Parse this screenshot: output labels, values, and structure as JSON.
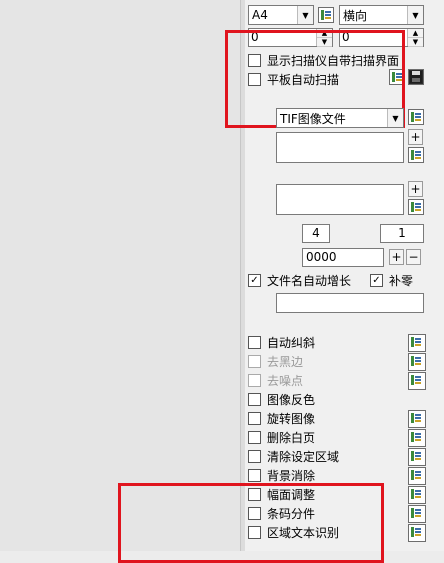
{
  "page_size": {
    "value": "A4"
  },
  "orientation": {
    "value": "横向"
  },
  "margin_left": {
    "value": "0"
  },
  "margin_right": {
    "value": "0"
  },
  "checkbox_show_scanner_ui": {
    "label": "显示扫描仪自带扫描界面",
    "checked": false
  },
  "checkbox_flatbed_auto": {
    "label": "平板自动扫描",
    "checked": false
  },
  "file_type": {
    "value": "TIF图像文件"
  },
  "counter": {
    "start": "4",
    "step": "1"
  },
  "name_pattern": {
    "value": "0000"
  },
  "checkbox_filename_autoincrement": {
    "label": "文件名自动增长",
    "checked": true
  },
  "checkbox_zero_pad": {
    "label": "补零",
    "checked": true
  },
  "processing_options": [
    {
      "label": "自动纠斜",
      "checked": false,
      "disabled": false
    },
    {
      "label": "去黑边",
      "checked": false,
      "disabled": true
    },
    {
      "label": "去噪点",
      "checked": false,
      "disabled": true
    },
    {
      "label": "图像反色",
      "checked": false,
      "disabled": false
    },
    {
      "label": "旋转图像",
      "checked": false,
      "disabled": false
    },
    {
      "label": "删除白页",
      "checked": false,
      "disabled": false
    },
    {
      "label": "清除设定区域",
      "checked": false,
      "disabled": false
    },
    {
      "label": "背景消除",
      "checked": false,
      "disabled": false
    },
    {
      "label": "幅面调整",
      "checked": false,
      "disabled": false
    },
    {
      "label": "条码分件",
      "checked": false,
      "disabled": false
    },
    {
      "label": "区域文本识别",
      "checked": false,
      "disabled": false
    }
  ],
  "symbols": {
    "plus": "+",
    "minus": "−",
    "check": "✓",
    "dropdown": "▼",
    "spin_up": "▲",
    "spin_down": "▼"
  },
  "colors": {
    "highlight": "#e0141e"
  }
}
